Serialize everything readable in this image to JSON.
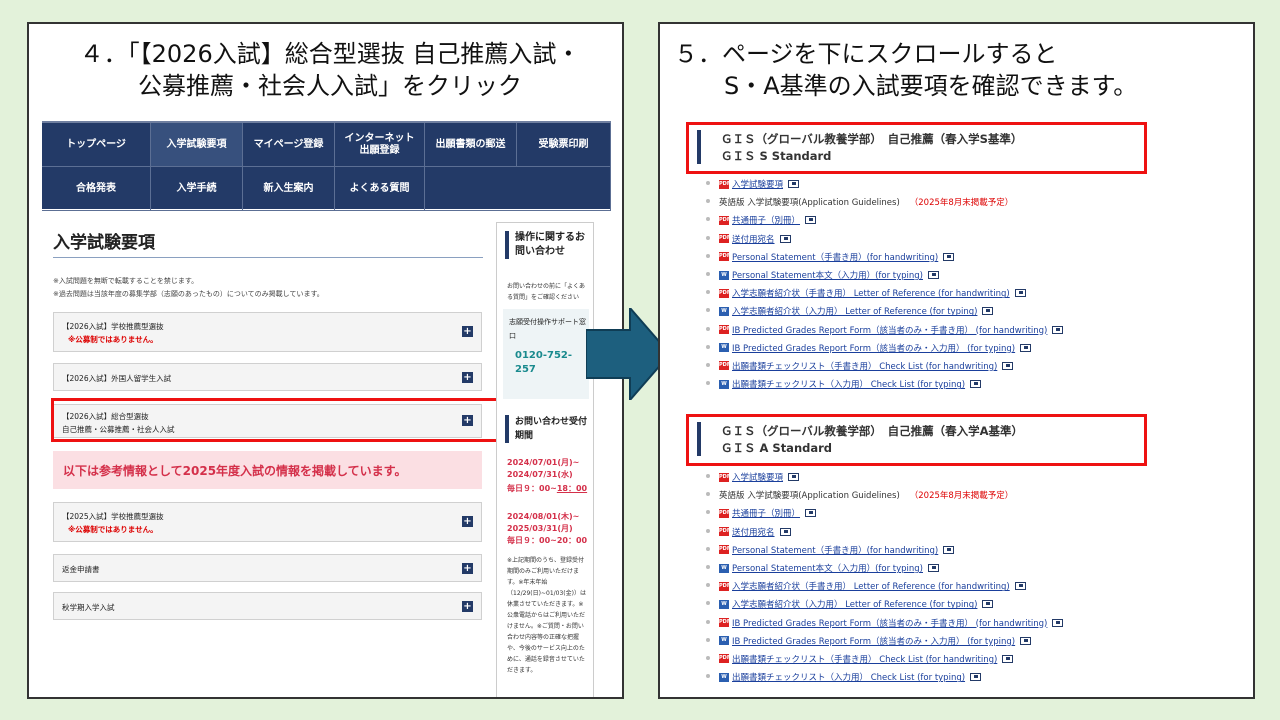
{
  "left": {
    "title_l1": "４．「【2026入試】総合型選抜 自己推薦入試・",
    "title_l2": "公募推薦・社会人入試」をクリック",
    "nav_row1": [
      "トップページ",
      "入学試験要項",
      "マイページ登録",
      "インターネット出願登録",
      "出願書類の郵送",
      "受験票印刷"
    ],
    "nav_row2": [
      "合格発表",
      "入学手続",
      "新入生案内",
      "よくある質問"
    ],
    "heading": "入学試験要項",
    "note1": "※入試問題を無断で転載することを禁じます。",
    "note2": "※過去問題は当該年度の募集学部（志願のあったもの）についてのみ掲載しています。",
    "acc1_t1": "【2026入試】学校推薦型選抜",
    "acc1_t2": "※公募制ではありません。",
    "acc2_t1": "【2026入試】外国人留学生入試",
    "acc3_t1": "【2026入試】総合型選抜",
    "acc3_t2": "自己推薦・公募推薦・社会人入試",
    "pink": "以下は参考情報として2025年度入試の情報を掲載しています。",
    "acc4_t1": "【2025入試】学校推薦型選抜",
    "acc4_t2": "※公募制ではありません。",
    "acc5_t1": "返金申請書",
    "acc6_t1": "秋学期入学入試",
    "plus": "+",
    "sb_head": "操作に関するお問い合わせ",
    "sb_small1": "お問い合わせの前に「よくある質問」をご確認ください",
    "sb_box_label": "志願受付操作サポート窓口",
    "sb_phone": "0120-752-257",
    "sb_head2": "お問い合わせ受付期間",
    "sb_date1": "2024/07/01(月)~ 2024/07/31(水)",
    "sb_date1_time_a": "毎日９：00~",
    "sb_date1_time_b": "18：00",
    "sb_date2": "2024/08/01(木)~ 2025/03/31(月)",
    "sb_date2_time": "毎日９：00~20：00",
    "sb_notes": "※上記期間のうち、登録受付期間のみご利用いただけます。※年末年始（12/29(日)~01/03(金)）は休業させていただきます。※公衆電話からはご利用いただけません。※ご質問・お問い合わせ内容等の正確な把握や、今後のサービス向上のために、通話を録音させていただきます。"
  },
  "right": {
    "title_l1": "５．ページを下にスクロールすると",
    "title_l2": "S・A基準の入試要項を確認できます。",
    "secS_l1": "ＧＩＳ（グローバル教養学部）　自己推薦（春入学S基準）",
    "secS_l2": "ＧＩＳ S Standard",
    "secA_l1": "ＧＩＳ（グローバル教養学部）　自己推薦（春入学A基準）",
    "secA_l2": "ＧＩＳ A Standard",
    "pdf_tag": "PDF",
    "doc_tag": "W",
    "items": [
      {
        "icon": "pdf",
        "text": "入学試験要項"
      },
      {
        "icon": "none",
        "text": "英語版 入学試験要項(Application Guidelines)",
        "red": "（2025年8月末掲載予定）"
      },
      {
        "icon": "pdf",
        "text": "共通冊子（別冊）"
      },
      {
        "icon": "pdf",
        "text": "送付用宛名"
      },
      {
        "icon": "pdf",
        "text": "Personal Statement（手書き用）(for handwriting)"
      },
      {
        "icon": "doc",
        "text": "Personal Statement本文（入力用）(for typing)"
      },
      {
        "icon": "pdf",
        "text": "入学志願者紹介状（手書き用） Letter of Reference (for handwriting)"
      },
      {
        "icon": "doc",
        "text": "入学志願者紹介状（入力用） Letter of Reference (for typing)"
      },
      {
        "icon": "pdf",
        "text": "IB Predicted Grades Report Form（該当者のみ・手書き用） (for handwriting)"
      },
      {
        "icon": "doc",
        "text": "IB Predicted Grades Report Form（該当者のみ・入力用） (for typing)"
      },
      {
        "icon": "pdf",
        "text": "出願書類チェックリスト（手書き用） Check List (for handwriting)"
      },
      {
        "icon": "doc",
        "text": "出願書類チェックリスト（入力用） Check List (for typing)"
      }
    ]
  }
}
